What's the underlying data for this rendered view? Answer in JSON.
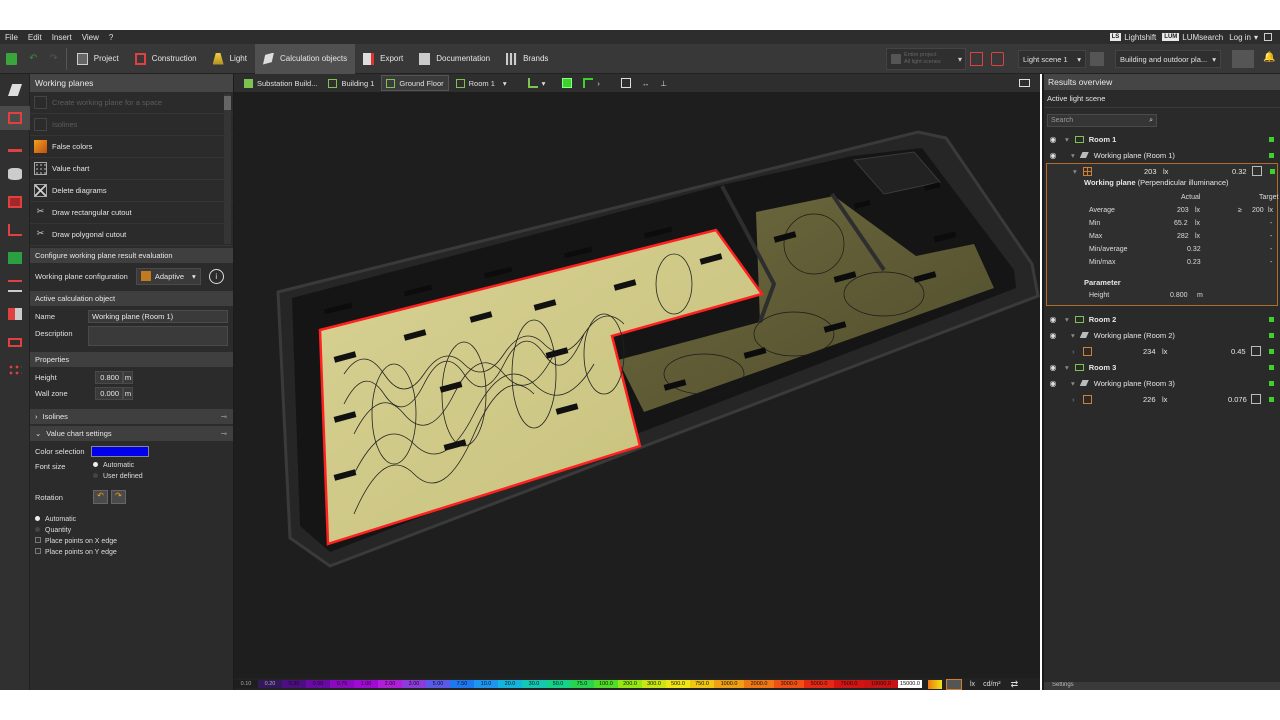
{
  "menu": {
    "items": [
      "File",
      "Edit",
      "Insert",
      "View",
      "?"
    ],
    "lightshift": "Lightshift",
    "lumsearch": "LUMsearch",
    "login": "Log in",
    "ls_badge": "LS",
    "lum_badge": "LUM"
  },
  "toolbar": {
    "items": [
      "Project",
      "Construction",
      "Light",
      "Calculation objects",
      "Export",
      "Documentation",
      "Brands"
    ],
    "entire_project": "Entire project",
    "all_light_scenes": "All light scenes",
    "light_scene": "Light scene 1",
    "building_dropdown": "Building and outdoor pla..."
  },
  "left_panel": {
    "title": "Working planes",
    "actions": [
      {
        "label": "Create working plane for a space",
        "enabled": false
      },
      {
        "label": "Isolines",
        "enabled": false
      },
      {
        "label": "False colors",
        "enabled": true
      },
      {
        "label": "Value chart",
        "enabled": true
      },
      {
        "label": "Delete diagrams",
        "enabled": true
      },
      {
        "label": "Draw rectangular cutout",
        "enabled": true
      },
      {
        "label": "Draw polygonal cutout",
        "enabled": true
      }
    ],
    "config_header": "Configure working plane result evaluation",
    "config_label": "Working plane configuration",
    "config_value": "Adaptive",
    "active_header": "Active calculation object",
    "name_label": "Name",
    "name_value": "Working plane (Room 1)",
    "description_label": "Description",
    "properties_header": "Properties",
    "height_label": "Height",
    "height_value": "0.800",
    "wall_zone_label": "Wall zone",
    "wall_zone_value": "0.000",
    "unit_m": "m",
    "isolines_section": "Isolines",
    "value_chart_section": "Value chart settings",
    "color_selection_label": "Color selection",
    "color_selection_value": "#0000ee",
    "font_size_label": "Font size",
    "font_opt_auto": "Automatic",
    "font_opt_user": "User defined",
    "rotation_label": "Rotation",
    "points_auto": "Automatic",
    "points_quantity": "Quantity",
    "place_x": "Place points on X edge",
    "place_y": "Place points on Y edge"
  },
  "viewport": {
    "breadcrumbs": [
      "Substation Build...",
      "Building 1",
      "Ground Floor",
      "Room 1"
    ],
    "legend_values": [
      "0.10",
      "0.20",
      "0.30",
      "0.50",
      "0.75",
      "1.00",
      "2.00",
      "3.00",
      "5.00",
      "7.50",
      "10.0",
      "20.0",
      "30.0",
      "50.0",
      "75.0",
      "100.0",
      "200.0",
      "300.0",
      "500.0",
      "750.0",
      "1000.0",
      "2000.0",
      "3000.0",
      "5000.0",
      "7500.0",
      "10000.0",
      "15000.0"
    ],
    "legend_colors": [
      "#1e1e1e",
      "#34195a",
      "#4b0f82",
      "#6a0aa4",
      "#8a0ac0",
      "#a00ad2",
      "#b01ed8",
      "#8c3cdc",
      "#5a5ae6",
      "#1e78f0",
      "#1e96f0",
      "#14b4dc",
      "#14c8b4",
      "#14d28c",
      "#28d250",
      "#50dc28",
      "#96e614",
      "#c8e614",
      "#f0e614",
      "#f0c814",
      "#f0a014",
      "#f07814",
      "#f05014",
      "#e62814",
      "#d21414",
      "#c81414",
      "#ffffff"
    ],
    "unit_lx": "lx",
    "unit_cd": "cd/m²"
  },
  "results": {
    "title": "Results overview",
    "subtitle": "Active light scene",
    "search_placeholder": "Search",
    "room1": "Room 1",
    "wp1": "Working plane (Room 1)",
    "wp1_value": "203",
    "wp1_ratio": "0.32",
    "detail_title": "Working plane",
    "detail_subtitle": "(Perpendicular illuminance)",
    "col_actual": "Actual",
    "col_target": "Target",
    "avg_label": "Average",
    "avg_actual": "203",
    "avg_target_op": "≥",
    "avg_target": "200",
    "min_label": "Min",
    "min_actual": "65.2",
    "max_label": "Max",
    "max_actual": "282",
    "minavg_label": "Min/average",
    "minavg_actual": "0.32",
    "minmax_label": "Min/max",
    "minmax_actual": "0.23",
    "dash": "-",
    "param_title": "Parameter",
    "height_label": "Height",
    "height_value": "0.800",
    "unit_m": "m",
    "unit_lx": "lx",
    "room2": "Room 2",
    "wp2": "Working plane (Room 2)",
    "wp2_value": "234",
    "wp2_ratio": "0.45",
    "room3": "Room 3",
    "wp3": "Working plane (Room 3)",
    "wp3_value": "226",
    "wp3_ratio": "0.076",
    "settings": "Settings"
  }
}
